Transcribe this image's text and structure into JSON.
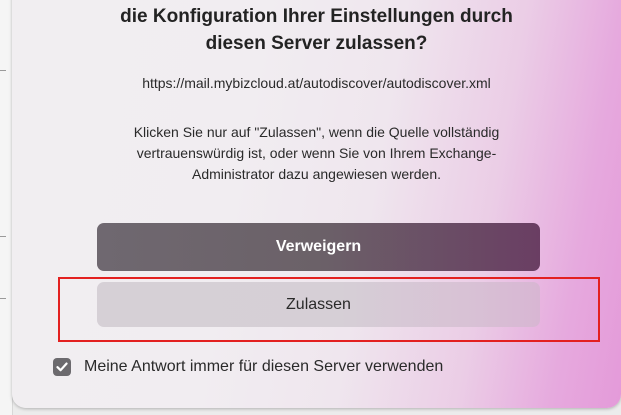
{
  "dialog": {
    "title_line1": "die Konfiguration Ihrer Einstellungen durch",
    "title_line2": "diesen Server zulassen?",
    "url": "https://mail.mybizcloud.at/autodiscover/autodiscover.xml",
    "message_line1": "Klicken Sie nur auf \"Zulassen\", wenn die Quelle vollständig",
    "message_line2": "vertrauenswürdig ist, oder wenn Sie von Ihrem Exchange-",
    "message_line3": "Administrator dazu angewiesen werden.",
    "deny_label": "Verweigern",
    "allow_label": "Zulassen",
    "checkbox_label": "Meine Antwort immer für diesen Server verwenden",
    "checkbox_checked": true
  },
  "colors": {
    "highlight": "#e32020",
    "deny_button": "#6b6168",
    "checkbox": "#6c6a6e"
  }
}
